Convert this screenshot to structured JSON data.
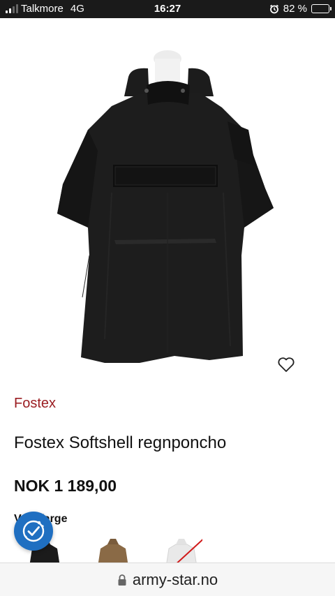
{
  "status_bar": {
    "carrier": "Talkmore",
    "network": "4G",
    "time": "16:27",
    "battery": "82 %",
    "battery_level": 0.82
  },
  "product": {
    "brand": "Fostex",
    "title": "Fostex Softshell regnponcho",
    "price": "NOK 1 189,00",
    "color_label": "Velg farge",
    "color_label_visible": "arge",
    "image_icon": "black-poncho-image",
    "wishlist_icon": "heart-icon",
    "swatches": [
      {
        "name": "black",
        "color": "#1b1b1b"
      },
      {
        "name": "coyote",
        "color": "#8a6a46"
      },
      {
        "name": "white",
        "color": "#e8e8e8"
      }
    ]
  },
  "cookie_badge": {
    "icon": "cookie-consent-icon",
    "color": "#1f6fc1"
  },
  "browser": {
    "url": "army-star.no",
    "lock_icon": "lock-icon"
  },
  "colors": {
    "brand_red": "#9b1d22",
    "text": "#111111"
  }
}
